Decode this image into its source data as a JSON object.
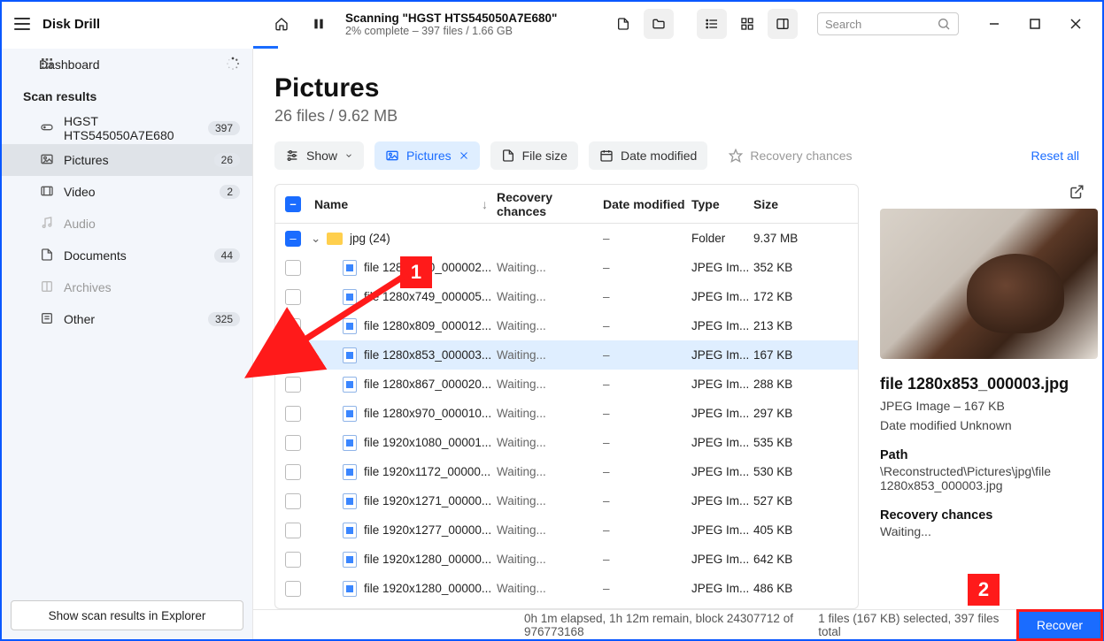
{
  "app_title": "Disk Drill",
  "scan": {
    "title": "Scanning \"HGST HTS545050A7E680\"",
    "status": "2% complete – 397 files / 1.66 GB"
  },
  "search": {
    "placeholder": "Search"
  },
  "sidebar": {
    "dashboard": "Dashboard",
    "scan_results": "Scan results",
    "items": [
      {
        "icon": "drive",
        "label": "HGST HTS545050A7E680",
        "badge": "397"
      },
      {
        "icon": "picture",
        "label": "Pictures",
        "badge": "26",
        "selected": true
      },
      {
        "icon": "video",
        "label": "Video",
        "badge": "2"
      },
      {
        "icon": "audio",
        "label": "Audio",
        "badge": "",
        "dim": true
      },
      {
        "icon": "doc",
        "label": "Documents",
        "badge": "44"
      },
      {
        "icon": "archive",
        "label": "Archives",
        "badge": "",
        "dim": true
      },
      {
        "icon": "other",
        "label": "Other",
        "badge": "325"
      }
    ],
    "footer_btn": "Show scan results in Explorer"
  },
  "main": {
    "title": "Pictures",
    "subtitle": "26 files / 9.62 MB",
    "filters": {
      "show": "Show",
      "pictures": "Pictures",
      "filesize": "File size",
      "datemod": "Date modified",
      "recchances": "Recovery chances",
      "reset": "Reset all"
    },
    "columns": {
      "name": "Name",
      "rec": "Recovery chances",
      "date": "Date modified",
      "type": "Type",
      "size": "Size"
    },
    "group": {
      "label": "jpg (24)",
      "date": "–",
      "type": "Folder",
      "size": "9.37 MB"
    },
    "rows": [
      {
        "name": "file 1280x720_000002...",
        "rec": "Waiting...",
        "date": "–",
        "type": "JPEG Im...",
        "size": "352 KB"
      },
      {
        "name": "file 1280x749_000005...",
        "rec": "Waiting...",
        "date": "–",
        "type": "JPEG Im...",
        "size": "172 KB"
      },
      {
        "name": "file 1280x809_000012...",
        "rec": "Waiting...",
        "date": "–",
        "type": "JPEG Im...",
        "size": "213 KB"
      },
      {
        "name": "file 1280x853_000003...",
        "rec": "Waiting...",
        "date": "–",
        "type": "JPEG Im...",
        "size": "167 KB",
        "selected": true
      },
      {
        "name": "file 1280x867_000020...",
        "rec": "Waiting...",
        "date": "–",
        "type": "JPEG Im...",
        "size": "288 KB"
      },
      {
        "name": "file 1280x970_000010...",
        "rec": "Waiting...",
        "date": "–",
        "type": "JPEG Im...",
        "size": "297 KB"
      },
      {
        "name": "file 1920x1080_00001...",
        "rec": "Waiting...",
        "date": "–",
        "type": "JPEG Im...",
        "size": "535 KB"
      },
      {
        "name": "file 1920x1172_00000...",
        "rec": "Waiting...",
        "date": "–",
        "type": "JPEG Im...",
        "size": "530 KB"
      },
      {
        "name": "file 1920x1271_00000...",
        "rec": "Waiting...",
        "date": "–",
        "type": "JPEG Im...",
        "size": "527 KB"
      },
      {
        "name": "file 1920x1277_00000...",
        "rec": "Waiting...",
        "date": "–",
        "type": "JPEG Im...",
        "size": "405 KB"
      },
      {
        "name": "file 1920x1280_00000...",
        "rec": "Waiting...",
        "date": "–",
        "type": "JPEG Im...",
        "size": "642 KB"
      },
      {
        "name": "file 1920x1280_00000...",
        "rec": "Waiting...",
        "date": "–",
        "type": "JPEG Im...",
        "size": "486 KB"
      }
    ]
  },
  "details": {
    "filename": "file 1280x853_000003.jpg",
    "meta": "JPEG Image – 167 KB",
    "date": "Date modified Unknown",
    "path_label": "Path",
    "path": "\\Reconstructed\\Pictures\\jpg\\file 1280x853_000003.jpg",
    "rec_label": "Recovery chances",
    "rec": "Waiting..."
  },
  "statusbar": {
    "elapsed": "0h 1m elapsed, 1h 12m remain, block 24307712 of 976773168",
    "selection": "1 files (167 KB) selected, 397 files total",
    "recover": "Recover"
  },
  "callouts": {
    "c1": "1",
    "c2": "2"
  }
}
